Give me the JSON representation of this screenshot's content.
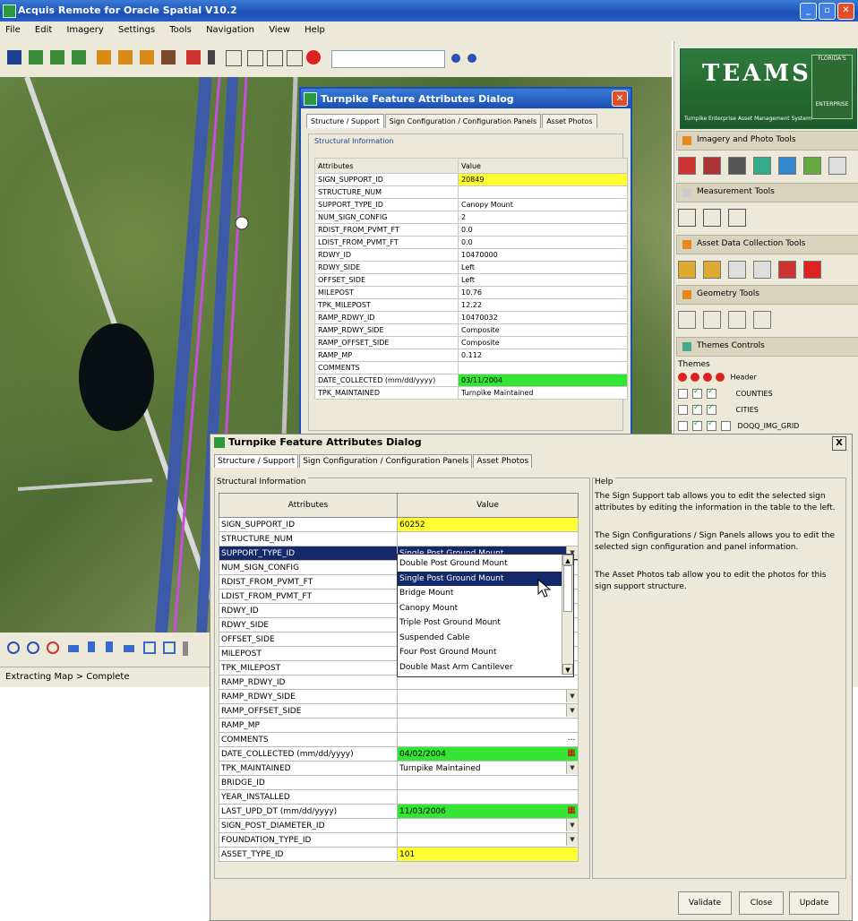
{
  "window": {
    "title": "Acquis Remote for Oracle Spatial V10.2",
    "buttons": [
      "_",
      "▫",
      "✕"
    ]
  },
  "menu": [
    "File",
    "Edit",
    "Imagery",
    "Settings",
    "Tools",
    "Navigation",
    "View",
    "Help"
  ],
  "statusbar": {
    "text": "Extracting Map > Complete"
  },
  "right_panel": {
    "logo": {
      "letters": "TEAMS",
      "subtitle": "Turnpike Enterprise Asset Management System",
      "florida": "FLORIDA'S",
      "enterprise": "ENTERPRISE"
    },
    "sections": [
      {
        "label": "Imagery and Photo Tools"
      },
      {
        "label": "Measurement Tools"
      },
      {
        "label": "Asset Data Collection Tools"
      },
      {
        "label": "Geometry Tools"
      },
      {
        "label": "Themes Controls"
      }
    ],
    "themes_label": "Themes",
    "themes": [
      {
        "name": "Header"
      },
      {
        "name": "COUNTIES"
      },
      {
        "name": "CITIES"
      },
      {
        "name": "DOQQ_IMG_GRID"
      }
    ]
  },
  "bg_dialog": {
    "title": "Turnpike Feature Attributes Dialog",
    "tabs": [
      "Structure / Support",
      "Sign Configuration / Configuration Panels",
      "Asset Photos"
    ],
    "group_label": "Structural Information",
    "headers": {
      "attr": "Attributes",
      "value": "Value"
    },
    "rows": [
      {
        "attr": "SIGN_SUPPORT_ID",
        "value": "20849",
        "style": "yellow"
      },
      {
        "attr": "STRUCTURE_NUM",
        "value": "",
        "style": ""
      },
      {
        "attr": "SUPPORT_TYPE_ID",
        "value": "Canopy Mount",
        "style": ""
      },
      {
        "attr": "NUM_SIGN_CONFIG",
        "value": "2",
        "style": ""
      },
      {
        "attr": "RDIST_FROM_PVMT_FT",
        "value": "0.0",
        "style": ""
      },
      {
        "attr": "LDIST_FROM_PVMT_FT",
        "value": "0.0",
        "style": ""
      },
      {
        "attr": "RDWY_ID",
        "value": "10470000",
        "style": ""
      },
      {
        "attr": "RDWY_SIDE",
        "value": "Left",
        "style": ""
      },
      {
        "attr": "OFFSET_SIDE",
        "value": "Left",
        "style": ""
      },
      {
        "attr": "MILEPOST",
        "value": "10.76",
        "style": ""
      },
      {
        "attr": "TPK_MILEPOST",
        "value": "12.22",
        "style": ""
      },
      {
        "attr": "RAMP_RDWY_ID",
        "value": "10470032",
        "style": ""
      },
      {
        "attr": "RAMP_RDWY_SIDE",
        "value": "Composite",
        "style": ""
      },
      {
        "attr": "RAMP_OFFSET_SIDE",
        "value": "Composite",
        "style": ""
      },
      {
        "attr": "RAMP_MP",
        "value": "0.112",
        "style": ""
      },
      {
        "attr": "COMMENTS",
        "value": "",
        "style": ""
      },
      {
        "attr": "DATE_COLLECTED (mm/dd/yyyy)",
        "value": "03/11/2004",
        "style": "green"
      },
      {
        "attr": "TPK_MAINTAINED",
        "value": "Turnpike Maintained",
        "style": ""
      }
    ]
  },
  "fg_dialog": {
    "title": "Turnpike Feature Attributes Dialog",
    "close": "X",
    "tabs": [
      "Structure / Support",
      "Sign Configuration / Configuration Panels",
      "Asset Photos"
    ],
    "group_label": "Structural Information",
    "headers": {
      "attr": "Attributes",
      "value": "Value"
    },
    "rows": [
      {
        "attr": "SIGN_SUPPORT_ID",
        "value": "60252",
        "style": "yellow",
        "widget": ""
      },
      {
        "attr": "STRUCTURE_NUM",
        "value": "",
        "style": "",
        "widget": ""
      },
      {
        "attr": "SUPPORT_TYPE_ID",
        "value": "Single Post Ground Mount",
        "style": "sel",
        "widget": "arrow"
      },
      {
        "attr": "NUM_SIGN_CONFIG",
        "value": "",
        "style": "",
        "widget": ""
      },
      {
        "attr": "RDIST_FROM_PVMT_FT",
        "value": "",
        "style": "",
        "widget": ""
      },
      {
        "attr": "LDIST_FROM_PVMT_FT",
        "value": "",
        "style": "",
        "widget": ""
      },
      {
        "attr": "RDWY_ID",
        "value": "",
        "style": "",
        "widget": ""
      },
      {
        "attr": "RDWY_SIDE",
        "value": "",
        "style": "",
        "widget": ""
      },
      {
        "attr": "OFFSET_SIDE",
        "value": "",
        "style": "",
        "widget": ""
      },
      {
        "attr": "MILEPOST",
        "value": "",
        "style": "",
        "widget": ""
      },
      {
        "attr": "TPK_MILEPOST",
        "value": "",
        "style": "",
        "widget": ""
      },
      {
        "attr": "RAMP_RDWY_ID",
        "value": "",
        "style": "",
        "widget": ""
      },
      {
        "attr": "RAMP_RDWY_SIDE",
        "value": "",
        "style": "",
        "widget": "arrow"
      },
      {
        "attr": "RAMP_OFFSET_SIDE",
        "value": "",
        "style": "",
        "widget": "arrow"
      },
      {
        "attr": "RAMP_MP",
        "value": "",
        "style": "",
        "widget": ""
      },
      {
        "attr": "COMMENTS",
        "value": "",
        "style": "",
        "widget": "ell"
      },
      {
        "attr": "DATE_COLLECTED (mm/dd/yyyy)",
        "value": "04/02/2004",
        "style": "green",
        "widget": "cal"
      },
      {
        "attr": "TPK_MAINTAINED",
        "value": "Turnpike Maintained",
        "style": "",
        "widget": "arrow"
      },
      {
        "attr": "BRIDGE_ID",
        "value": "",
        "style": "",
        "widget": ""
      },
      {
        "attr": "YEAR_INSTALLED",
        "value": "",
        "style": "",
        "widget": ""
      },
      {
        "attr": "LAST_UPD_DT (mm/dd/yyyy)",
        "value": "11/03/2006",
        "style": "green",
        "widget": "cal"
      },
      {
        "attr": "SIGN_POST_DIAMETER_ID",
        "value": "",
        "style": "",
        "widget": "arrow"
      },
      {
        "attr": "FOUNDATION_TYPE_ID",
        "value": "",
        "style": "",
        "widget": "arrow"
      },
      {
        "attr": "ASSET_TYPE_ID",
        "value": "101",
        "style": "yellow",
        "widget": ""
      }
    ],
    "dropdown_options": [
      "Double Post Ground Mount",
      "Single Post Ground Mount",
      "Bridge Mount",
      "Canopy Mount",
      "Triple Post Ground Mount",
      "Suspended Cable",
      "Four Post Ground Mount",
      "Double Mast Arm Cantilever"
    ],
    "dropdown_highlight": "Single Post Ground Mount",
    "help_label": "Help",
    "help_paragraphs": [
      "The Sign Support tab allows you to edit the selected sign attributes by editing the information in the table to the left.",
      "The Sign Configurations / Sign Panels allows you to edit the selected sign configuration and panel information.",
      "The Asset Photos tab allow you to edit the photos for this sign support structure."
    ],
    "buttons": {
      "validate": "Validate",
      "close": "Close",
      "update": "Update"
    }
  },
  "colors": {
    "title_blue": "#1b4fb5",
    "required_yellow": "#ffff33",
    "date_green": "#33e633",
    "selection_navy": "#14286a"
  }
}
